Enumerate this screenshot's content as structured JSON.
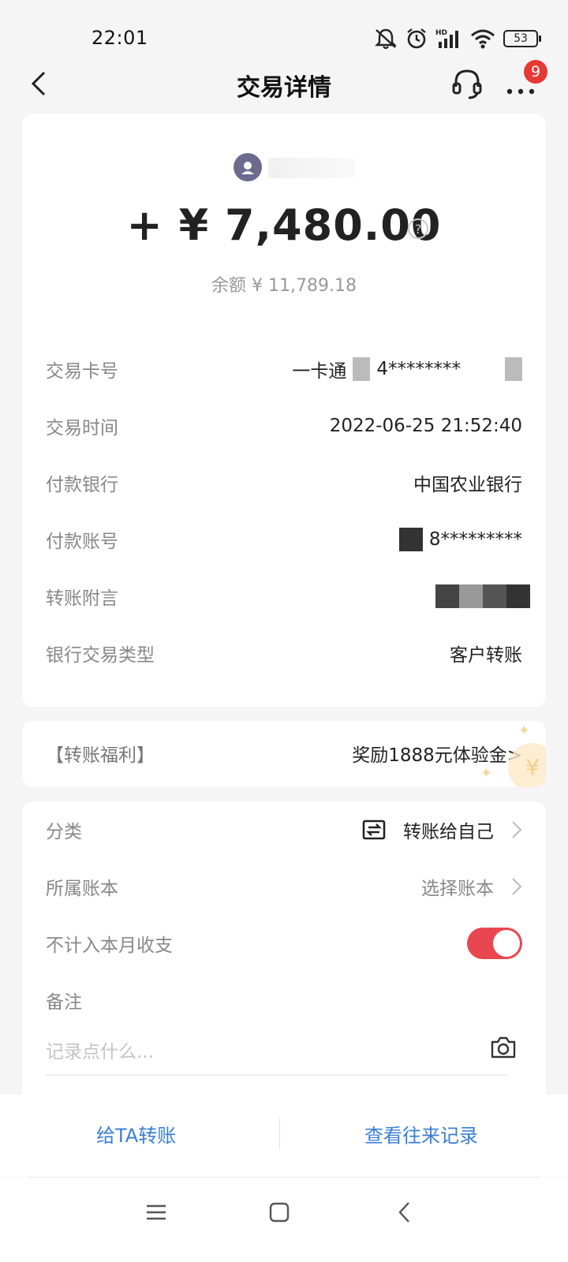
{
  "status_bar": {
    "time": "22:01",
    "battery": "53",
    "icons": [
      "mute-icon",
      "alarm-icon",
      "signal-icon",
      "wifi-icon",
      "battery-icon"
    ]
  },
  "header": {
    "title": "交易详情",
    "badge_count": "9"
  },
  "transaction": {
    "amount": "+ ¥ 7,480.00",
    "balance": "余额 ¥ 11,789.18"
  },
  "details": [
    {
      "label": "交易卡号",
      "value": "一卡通"
    },
    {
      "label": "交易时间",
      "value": "2022-06-25 21:52:40"
    },
    {
      "label": "付款银行",
      "value": "中国农业银行"
    },
    {
      "label": "付款账号",
      "value": "8*********"
    },
    {
      "label": "转账附言",
      "value": ""
    },
    {
      "label": "银行交易类型",
      "value": "客户转账"
    }
  ],
  "card_number_suffix": "4********",
  "benefit": {
    "label": "【转账福利】",
    "value": "奖励1888元体验金>"
  },
  "extra": {
    "category_label": "分类",
    "category_value": "转账给自己",
    "ledger_label": "所属账本",
    "ledger_value": "选择账本",
    "exclude_label": "不计入本月收支",
    "note_label": "备注",
    "note_placeholder": "记录点什么..."
  },
  "actions": {
    "transfer": "给TA转账",
    "history": "查看往来记录"
  },
  "colors": {
    "accent_blue": "#3b7fd4",
    "toggle_red": "#e8474f",
    "badge_red": "#e53935"
  }
}
